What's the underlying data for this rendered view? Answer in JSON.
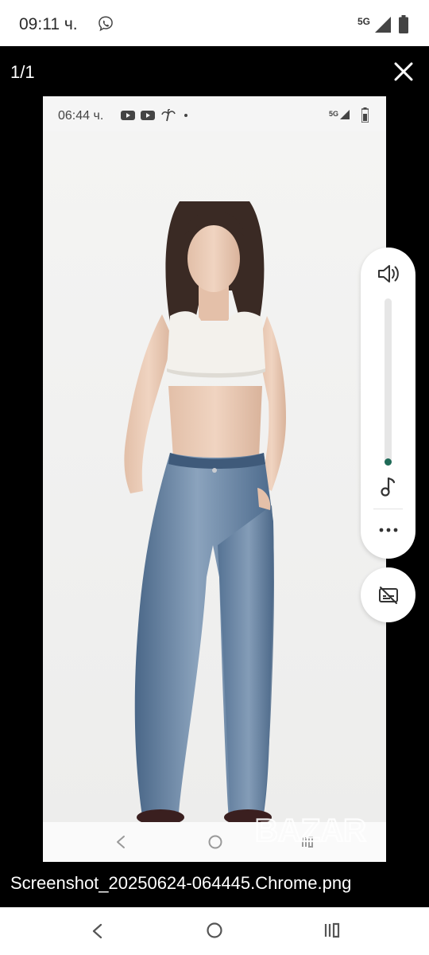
{
  "status_bar": {
    "time": "09:11 ч.",
    "network": "5G",
    "icons": [
      "viber-icon",
      "signal-icon",
      "battery-icon"
    ]
  },
  "viewer": {
    "counter": "1/1",
    "close_icon": "close-icon",
    "filename": "Screenshot_20250624-064445.Chrome.png"
  },
  "inner_screenshot": {
    "status_bar": {
      "time": "06:44 ч.",
      "network": "5G",
      "icons": [
        "youtube-icon",
        "youtube-icon",
        "palm-tree-icon",
        "dot-icon",
        "signal-icon",
        "battery-icon"
      ]
    },
    "watermark": "BAZAR",
    "nav_icons": [
      "back-icon",
      "home-icon",
      "recents-icon"
    ]
  },
  "volume_panel": {
    "level_fraction": 0.03,
    "accent": "#1f6a57",
    "icons": [
      "speaker-icon",
      "music-note-icon",
      "more-icon"
    ]
  },
  "caption_button": {
    "icon": "captions-off-icon"
  },
  "navigation_bar": {
    "icons": [
      "back-icon",
      "home-icon",
      "recents-icon"
    ]
  }
}
